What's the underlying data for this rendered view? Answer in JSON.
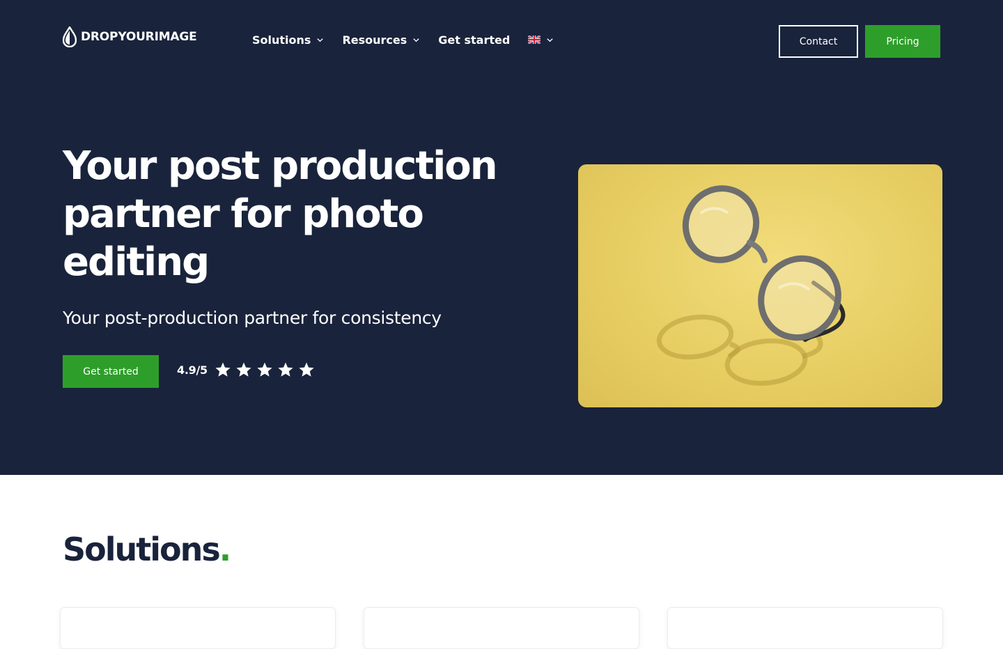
{
  "brand": {
    "name": "DROPYOURIMAGE"
  },
  "nav": {
    "items": [
      {
        "label": "Solutions",
        "dropdown": true
      },
      {
        "label": "Resources",
        "dropdown": true
      },
      {
        "label": "Get started",
        "dropdown": false
      }
    ],
    "language": {
      "icon": "uk-flag-icon",
      "dropdown": true
    }
  },
  "header_buttons": {
    "contact": "Contact",
    "pricing": "Pricing"
  },
  "hero": {
    "title": "Your post production partner for photo editing",
    "subtitle": "Your post-production partner for consistency",
    "cta": "Get started",
    "rating": "4.9/5",
    "stars": 5,
    "image_icon": "glasses-photo"
  },
  "solutions": {
    "title": "Solutions",
    "title_dot": "."
  },
  "colors": {
    "hero_bg": "#19233b",
    "accent_green": "#2e9e2a",
    "white": "#ffffff",
    "image_yellow": "#e7ce63"
  }
}
